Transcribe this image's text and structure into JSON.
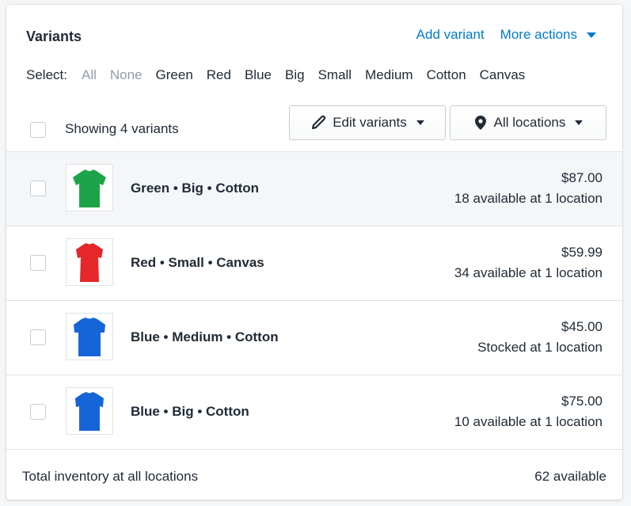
{
  "header": {
    "title": "Variants",
    "add_variant": "Add variant",
    "more_actions": "More actions",
    "link_color": "#007ace"
  },
  "select": {
    "label": "Select:",
    "options": [
      {
        "label": "All",
        "muted": true
      },
      {
        "label": "None",
        "muted": true
      },
      {
        "label": "Green",
        "muted": false
      },
      {
        "label": "Red",
        "muted": false
      },
      {
        "label": "Blue",
        "muted": false
      },
      {
        "label": "Big",
        "muted": false
      },
      {
        "label": "Small",
        "muted": false
      },
      {
        "label": "Medium",
        "muted": false
      },
      {
        "label": "Cotton",
        "muted": false
      },
      {
        "label": "Canvas",
        "muted": false
      }
    ]
  },
  "bulk": {
    "count_label": "Showing 4 variants",
    "edit_button": "Edit variants",
    "edit_icon": "pencil-icon",
    "locations_button": "All locations",
    "locations_icon": "location-pin-icon"
  },
  "variants": [
    {
      "name": "Green • Big • Cotton",
      "price": "$87.00",
      "availability": "18 available at 1 location",
      "shirt_color": "#1ea448",
      "highlighted": true
    },
    {
      "name": "Red • Small • Canvas",
      "price": "$59.99",
      "availability": "34 available at 1 location",
      "shirt_color": "#e5262a",
      "highlighted": false
    },
    {
      "name": "Blue • Medium • Cotton",
      "price": "$45.00",
      "availability": "Stocked at 1 location",
      "shirt_color": "#1565d8",
      "highlighted": false
    },
    {
      "name": "Blue • Big • Cotton",
      "price": "$75.00",
      "availability": "10 available at 1 location",
      "shirt_color": "#1565d8",
      "highlighted": false
    }
  ],
  "footer": {
    "total_label": "Total inventory at all locations",
    "total_value": "62 available"
  }
}
